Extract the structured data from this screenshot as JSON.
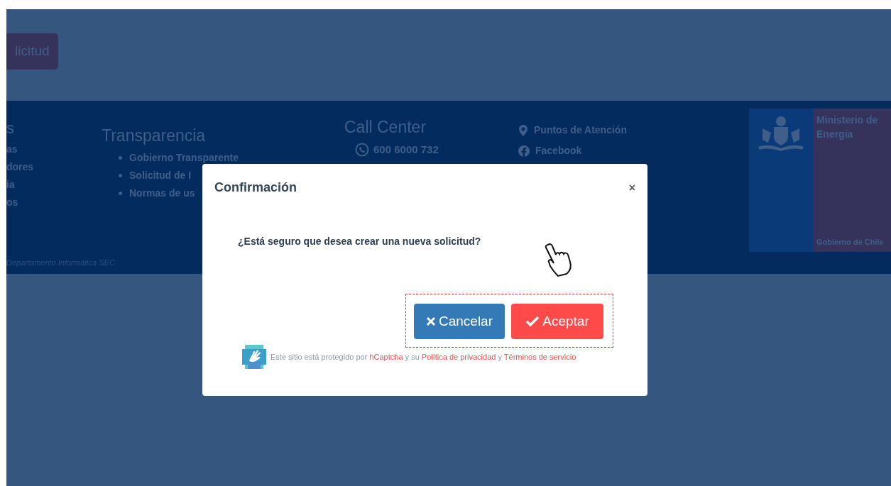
{
  "top_button": {
    "label": "licitud"
  },
  "footer": {
    "column_1": {
      "heading": "s",
      "items": [
        "as",
        "dores",
        "ia",
        "os"
      ]
    },
    "transparency": {
      "heading": "Transparencia",
      "items": [
        "Gobierno Transparente",
        "Solicitud de I",
        "Normas de us"
      ]
    },
    "call_center": {
      "heading": "Call Center",
      "phone": "600 6000 732"
    },
    "links": [
      {
        "kind": "pin",
        "label": "Puntos de Atención"
      },
      {
        "kind": "facebook",
        "label": "Facebook"
      }
    ],
    "credit": "Departamento Informática SEC",
    "logo": {
      "ministry": "Ministerio de Energía",
      "government": "Gobierno de Chile"
    }
  },
  "dialog": {
    "title": "Confirmación",
    "close": "×",
    "message": "¿Está seguro que desea crear una nueva solicitud?",
    "buttons": [
      {
        "kind": "cancel",
        "label": "Cancelar"
      },
      {
        "kind": "accept",
        "label": "Aceptar"
      }
    ],
    "captcha": {
      "before": "Este sitio está protegido por",
      "link_1": "hCaptcha",
      "middle": "y su",
      "link_2": "Política de privacidad",
      "joiner": "y",
      "link_3": "Términos de servicio"
    }
  }
}
